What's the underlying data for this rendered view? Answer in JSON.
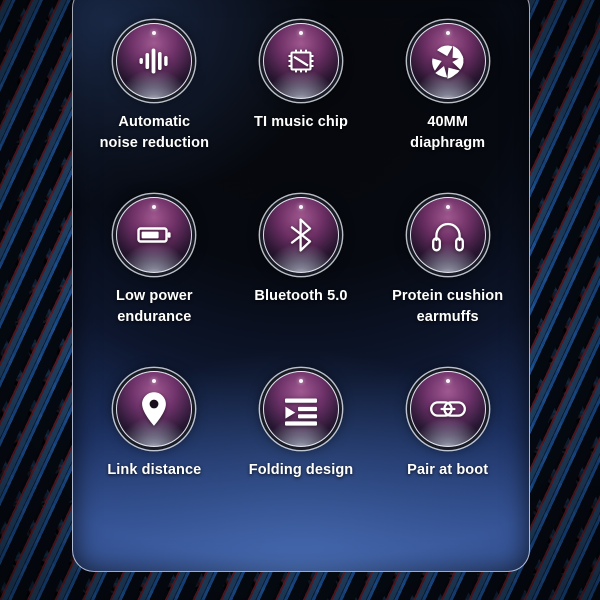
{
  "theme": {
    "card_bg_top": "#06080c",
    "card_bg_bottom": "#2c4a8e",
    "badge_accent": "#a85c96",
    "caption_color": "#ffffff",
    "braid_blue": "#5aa0eb",
    "braid_red": "#e94a60"
  },
  "features": [
    {
      "id": "automatic-noise-reduction",
      "icon": "sound-wave-icon",
      "label": "Automatic\nnoise reduction"
    },
    {
      "id": "ti-music-chip",
      "icon": "chip-icon",
      "label": "TI music chip"
    },
    {
      "id": "40mm-diaphragm",
      "icon": "aperture-icon",
      "label": "40MM\ndiaphragm"
    },
    {
      "id": "low-power-endurance",
      "icon": "battery-icon",
      "label": "Low power\nendurance"
    },
    {
      "id": "bluetooth-5-0",
      "icon": "bluetooth-icon",
      "label": "Bluetooth 5.0"
    },
    {
      "id": "protein-cushion-earmuffs",
      "icon": "headphones-icon",
      "label": "Protein cushion\nearmuffs"
    },
    {
      "id": "link-distance",
      "icon": "map-pin-icon",
      "label": "Link distance"
    },
    {
      "id": "folding-design",
      "icon": "fold-indent-icon",
      "label": "Folding design"
    },
    {
      "id": "pair-at-boot",
      "icon": "chain-link-icon",
      "label": "Pair at boot"
    }
  ]
}
